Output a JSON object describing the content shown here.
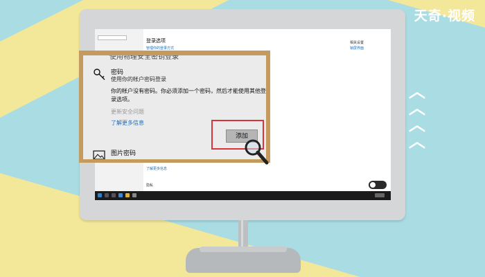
{
  "brand": "天奇·视频",
  "colors": {
    "accent": "#1a6fbf",
    "highlight": "#d8323a",
    "panel_frame": "#c59a5e"
  },
  "settings": {
    "page_title": "登录选项",
    "subtitle": "管理你的登录方式",
    "right_links": [
      "相关设置",
      "锁屏界面"
    ],
    "bottom_links": [
      "了解更多信息"
    ],
    "bottom_heading": "隐私"
  },
  "panel": {
    "cut_top_text": "使用物理安全密钥登录",
    "password_title": "密码",
    "password_subtitle": "使用你的帐户密码登录",
    "description_line1": "你的帐户没有密码。你必须添加一个密码，然后才能使用其他登",
    "description_line2": "录选项。",
    "disabled_link": "更新安全问题",
    "learn_more_link": "了解更多信息",
    "add_button": "添加",
    "picture_password_title": "图片密码"
  },
  "icons": [
    "key-icon",
    "picture-icon",
    "magnifier-icon",
    "chevron-up-icon"
  ]
}
